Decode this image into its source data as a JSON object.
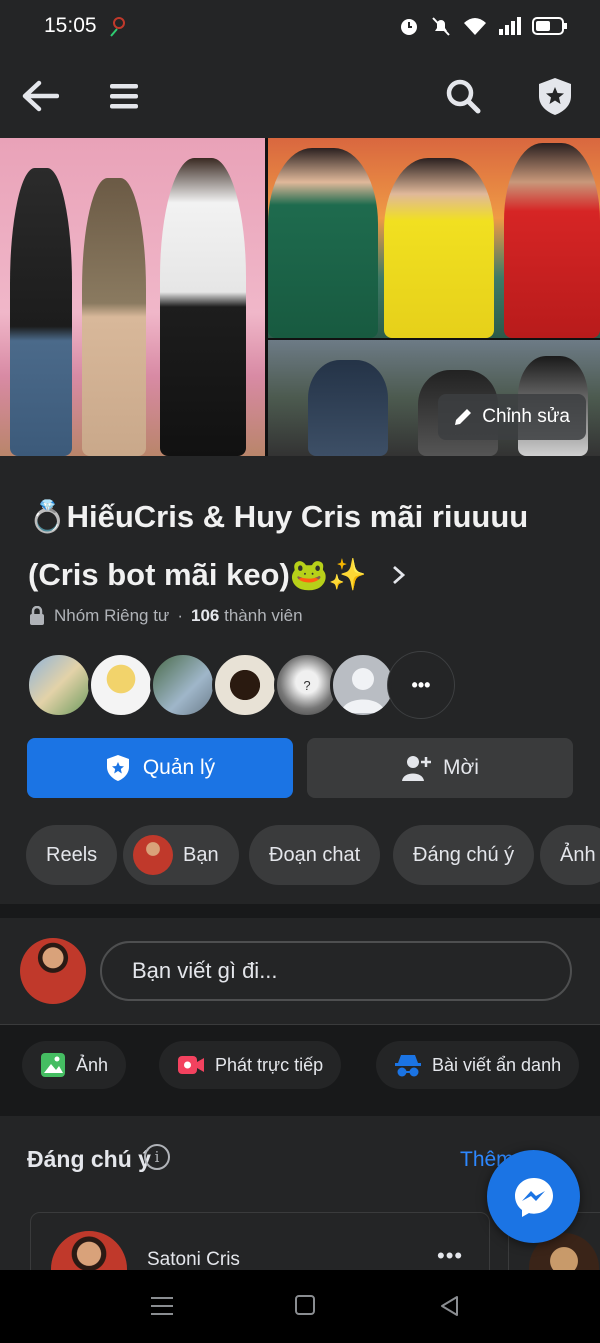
{
  "status": {
    "time": "15:05"
  },
  "cover": {
    "edit_label": "Chỉnh sửa"
  },
  "group": {
    "title": "💍HiếuCris & Huy Cris mãi riuuuu (Cris bot mãi keo)🐸✨",
    "privacy": "Nhóm Riêng tư",
    "separator": "·",
    "member_count": "106",
    "member_label": "thành viên"
  },
  "actions": {
    "manage_label": "Quản lý",
    "invite_label": "Mời"
  },
  "chips": [
    "Reels",
    "Bạn",
    "Đoạn chat",
    "Đáng chú ý",
    "Ảnh"
  ],
  "composer": {
    "placeholder": "Bạn viết gì đi..."
  },
  "post_actions": [
    "Ảnh",
    "Phát trực tiếp",
    "Bài viết ẩn danh"
  ],
  "featured": {
    "title": "Đáng chú ý",
    "info": "i",
    "more_label": "Thêm",
    "card_name": "Satoni Cris",
    "card_menu": "•••"
  },
  "more_members": "•••",
  "colors": {
    "accent": "#1b74e4",
    "bg": "#242526",
    "link": "#2d88ff"
  }
}
